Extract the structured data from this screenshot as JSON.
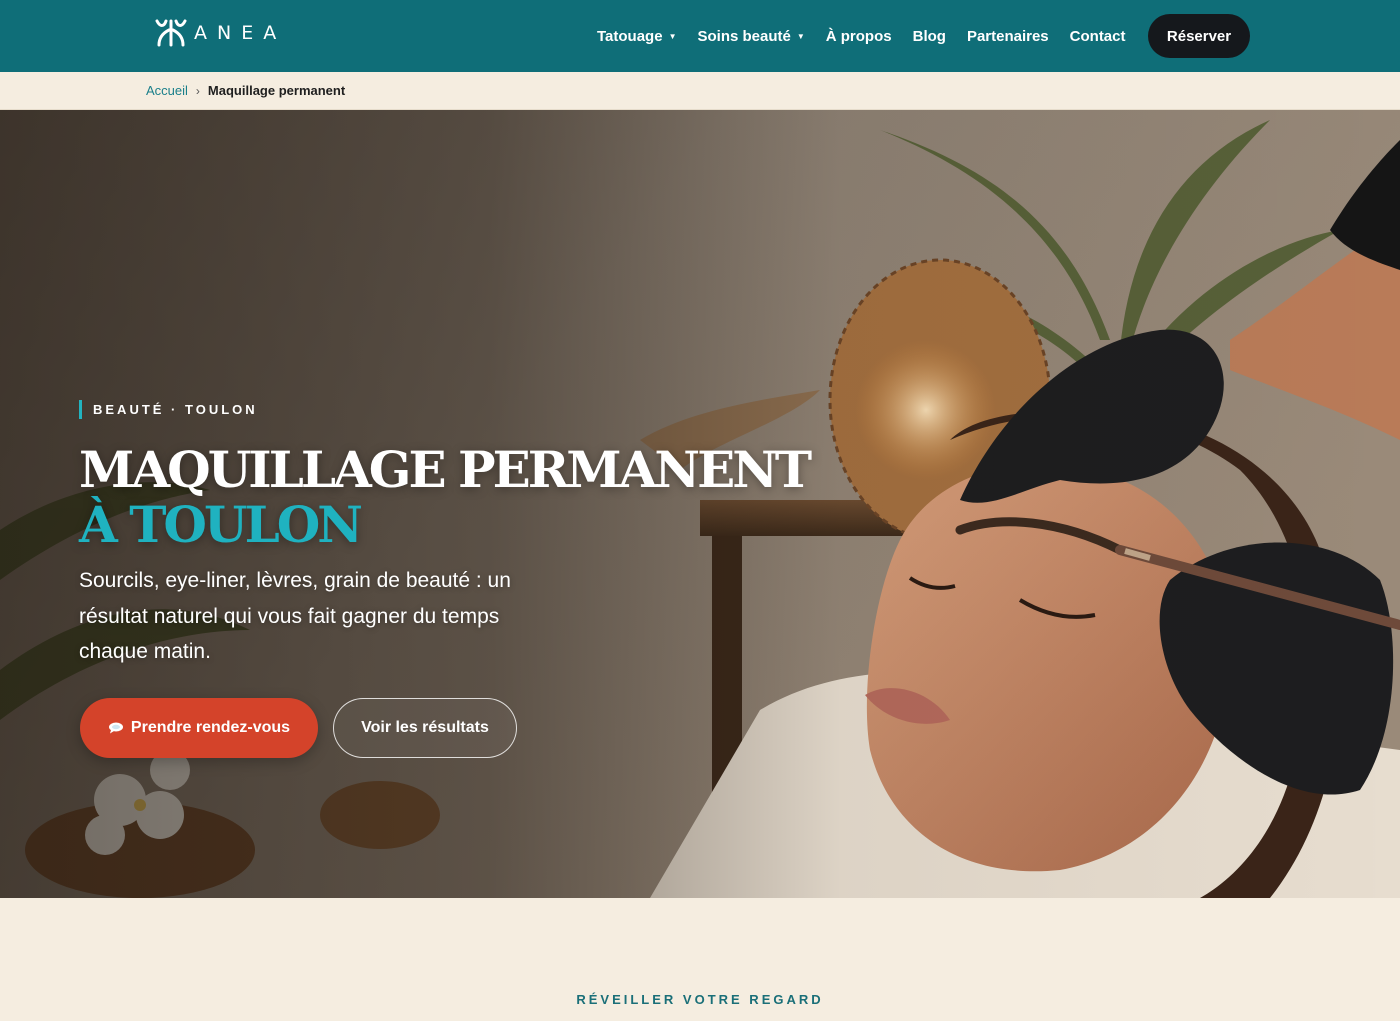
{
  "header": {
    "logo_text": "ANEA",
    "nav": [
      {
        "label": "Tatouage",
        "has_dropdown": true
      },
      {
        "label": "Soins beauté",
        "has_dropdown": true
      },
      {
        "label": "À propos",
        "has_dropdown": false
      },
      {
        "label": "Blog",
        "has_dropdown": false
      },
      {
        "label": "Partenaires",
        "has_dropdown": false
      },
      {
        "label": "Contact",
        "has_dropdown": false
      }
    ],
    "cta_label": "Réserver"
  },
  "breadcrumb": {
    "home": "Accueil",
    "separator": "›",
    "current": "Maquillage permanent"
  },
  "hero": {
    "eyebrow": "BEAUTÉ · TOULON",
    "title_line1": "MAQUILLAGE PERMANENT",
    "title_line2": "À TOULON",
    "subtitle": "Sourcils, eye-liner, lèvres, grain de beauté : un résultat naturel qui vous fait gagner du temps chaque matin.",
    "primary_button": "Prendre rendez-vous",
    "secondary_button": "Voir les résultats"
  },
  "section": {
    "eyebrow": "RÉVEILLER VOTRE REGARD"
  },
  "colors": {
    "header_bg": "#0f6e78",
    "accent_teal": "#1fb2c0",
    "cta_orange": "#d4432a",
    "reserve_dark": "#15181c",
    "cream_bg": "#f5ede0"
  },
  "icons": {
    "primary_button_icon": "speech-bubble-icon",
    "nav_dropdown_icon": "caret-down-icon",
    "breadcrumb_separator_icon": "chevron-right-icon"
  }
}
